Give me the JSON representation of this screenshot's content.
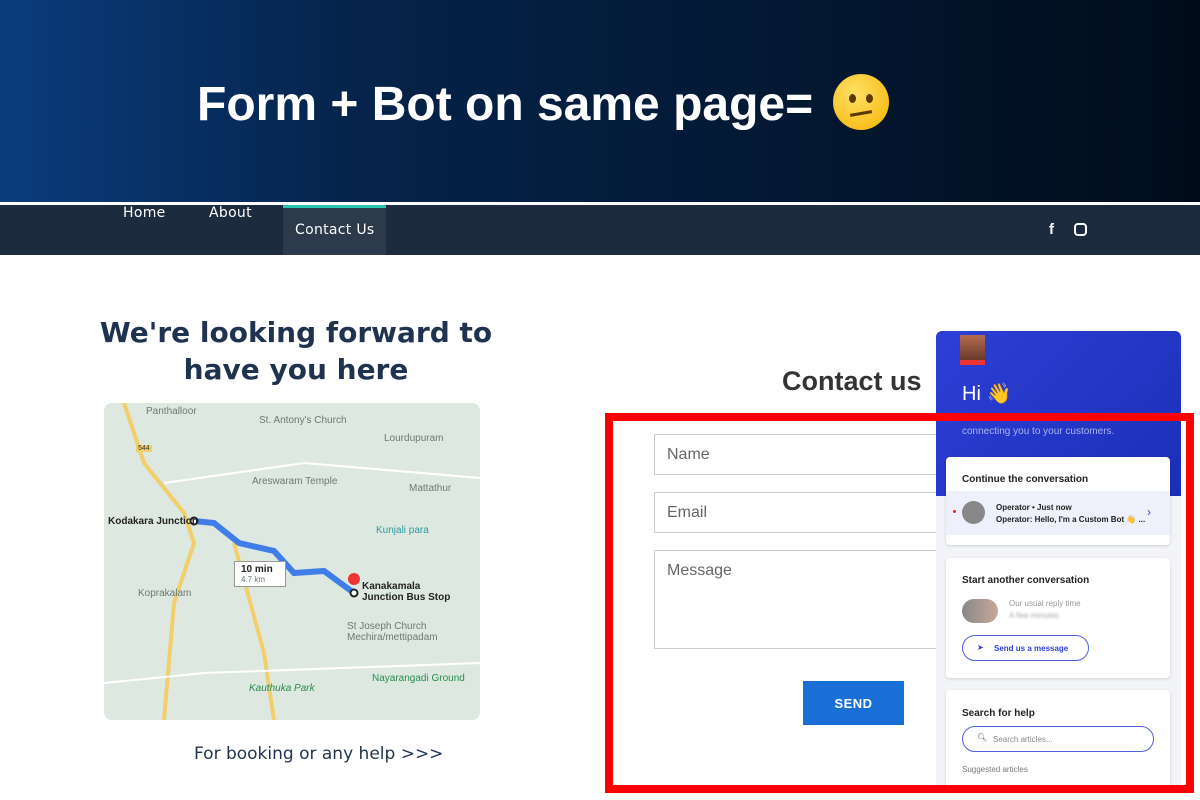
{
  "banner": {
    "title": "Form + Bot on same page=",
    "emoji": "confused-face"
  },
  "nav": {
    "items": [
      {
        "label": "Home"
      },
      {
        "label": "About"
      },
      {
        "label": "Contact Us",
        "active": true
      }
    ],
    "social": [
      "facebook-icon",
      "instagram-icon"
    ]
  },
  "left": {
    "heading": "We're looking forward to have you here",
    "help": "For booking or any help >>>"
  },
  "map": {
    "labels": [
      "Panthalloor",
      "St. Antony's Church",
      "Lourdupuram",
      "Areswaram Temple",
      "Mattathur",
      "Kodakara Junction",
      "Kunjali para",
      "Koprakalam",
      "Kanakamala Junction Bus Stop",
      "St Joseph Church Mechira/mettipadam",
      "Nayarangadi Ground",
      "Kauthuka Park",
      "544"
    ],
    "route": {
      "time": "10 min",
      "distance": "4.7 km"
    }
  },
  "form": {
    "title": "Contact us",
    "name_placeholder": "Name",
    "email_placeholder": "Email",
    "message_placeholder": "Message",
    "send": "SEND"
  },
  "widget": {
    "greeting": "Hi 👋",
    "subtitle": "connecting you to your customers.",
    "continue_title": "Continue the conversation",
    "conv_meta": "Operator • Just now",
    "conv_preview": "Operator: Hello, I'm a Custom Bot 👋 ...",
    "start_title": "Start another conversation",
    "reply_label": "Our usual reply time",
    "reply_value": "A few minutes",
    "send_message": "Send us a message",
    "search_title": "Search for help",
    "search_placeholder": "Search articles...",
    "suggested": "Suggested articles"
  },
  "colors": {
    "highlight": "#ff0000",
    "accent": "#1a6fd6",
    "widget": "#2d3fd6",
    "nav": "#1c2b3e"
  }
}
